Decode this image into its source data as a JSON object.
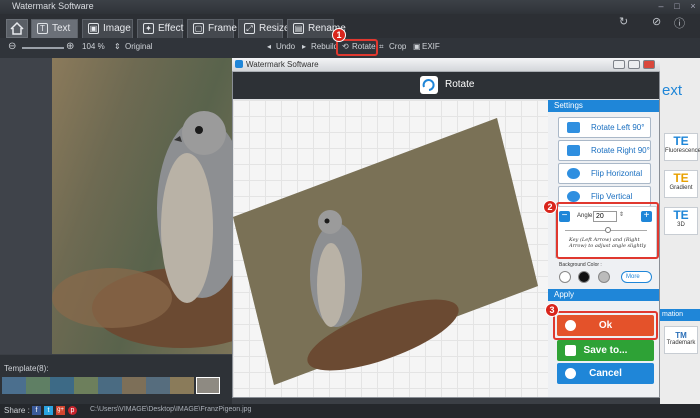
{
  "window": {
    "title": "Watermark Software"
  },
  "tabs": [
    {
      "label": "Text",
      "icon": "text-icon"
    },
    {
      "label": "Image",
      "icon": "image-icon"
    },
    {
      "label": "Effect",
      "icon": "effect-icon"
    },
    {
      "label": "Frame",
      "icon": "frame-icon"
    },
    {
      "label": "Resize",
      "icon": "resize-icon"
    },
    {
      "label": "Rename",
      "icon": "rename-icon"
    }
  ],
  "toolbar": {
    "zoom": "104 %",
    "original": "Original",
    "undo": "Undo",
    "rebuild": "Rebuild",
    "rotate": "Rotate",
    "crop": "Crop",
    "exif": "EXIF"
  },
  "template": {
    "label": "Template(8):"
  },
  "footer": {
    "share_label": "Share :",
    "path": "C:\\Users\\VIMAGE\\Desktop\\IMAGE\\FranzPigeon.jpg"
  },
  "dialog": {
    "title": "Watermark Software",
    "header": "Rotate",
    "settings_label": "Settings",
    "rotate_left": "Rotate Left 90°",
    "rotate_right": "Rotate Right 90°",
    "flip_horizontal": "Flip Horizontal",
    "flip_vertical": "Flip Vertical",
    "angle_label": "Angle:",
    "angle_value": "20",
    "hint": "Key (Left Arrow) and (Right Arrow) to adjust angle slightly",
    "background_label": "Background Color :",
    "more": "More",
    "apply_label": "Apply",
    "ok": "Ok",
    "save": "Save to...",
    "cancel": "Cancel"
  },
  "right_panel": {
    "partial_text": "ext",
    "tiles": [
      "Fluorescence",
      "Gradient",
      "3D"
    ],
    "mation": "mation",
    "tm": "TM",
    "trademark": "Trademark"
  },
  "badges": [
    "1",
    "2",
    "3"
  ],
  "colors": {
    "accent": "#1f86d8",
    "ok": "#e4522a",
    "save": "#2ea236",
    "cancel": "#1f86d8",
    "highlight": "#e0382f"
  }
}
